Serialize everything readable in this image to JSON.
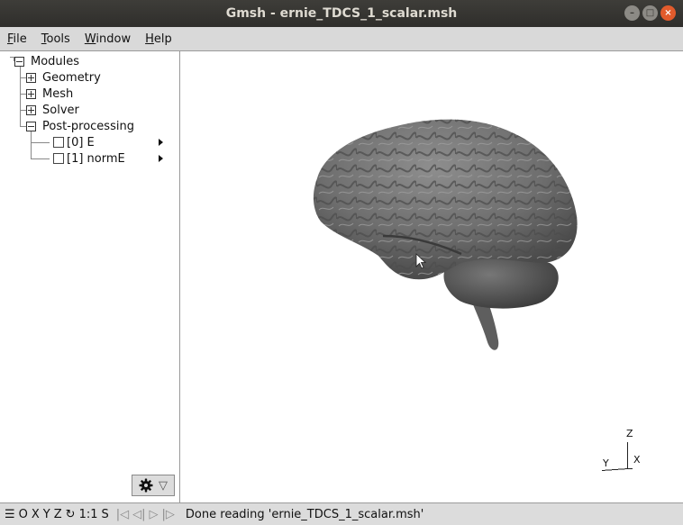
{
  "window": {
    "title": "Gmsh - ernie_TDCS_1_scalar.msh",
    "controls": [
      "–",
      "□",
      "×"
    ]
  },
  "menu": [
    {
      "label": "File",
      "mnemonic": "F",
      "rest": "ile"
    },
    {
      "label": "Tools",
      "mnemonic": "T",
      "rest": "ools"
    },
    {
      "label": "Window",
      "mnemonic": "W",
      "rest": "indow"
    },
    {
      "label": "Help",
      "mnemonic": "H",
      "rest": "elp"
    }
  ],
  "tree": {
    "root": "Modules",
    "items": [
      "Geometry",
      "Mesh",
      "Solver",
      "Post-processing"
    ],
    "views": [
      "[0] E",
      "[1] normE"
    ]
  },
  "gear_button": {
    "icon": "gear-icon",
    "caret": "▽"
  },
  "axes": {
    "x": "X",
    "y": "Y",
    "z": "Z"
  },
  "statusbar": {
    "menu_icon": "☰",
    "buttons": [
      "O",
      "X",
      "Y",
      "Z"
    ],
    "rotate_icon": "↻",
    "scale": "1:1",
    "select": "S",
    "nav": [
      "|◁",
      "◁|",
      "▷",
      "|▷"
    ],
    "message": "Done reading 'ernie_TDCS_1_scalar.msh'"
  },
  "colors": {
    "brain": "#7a7a7a",
    "titlebar": "#2f2e2b",
    "close": "#e25b2c"
  }
}
